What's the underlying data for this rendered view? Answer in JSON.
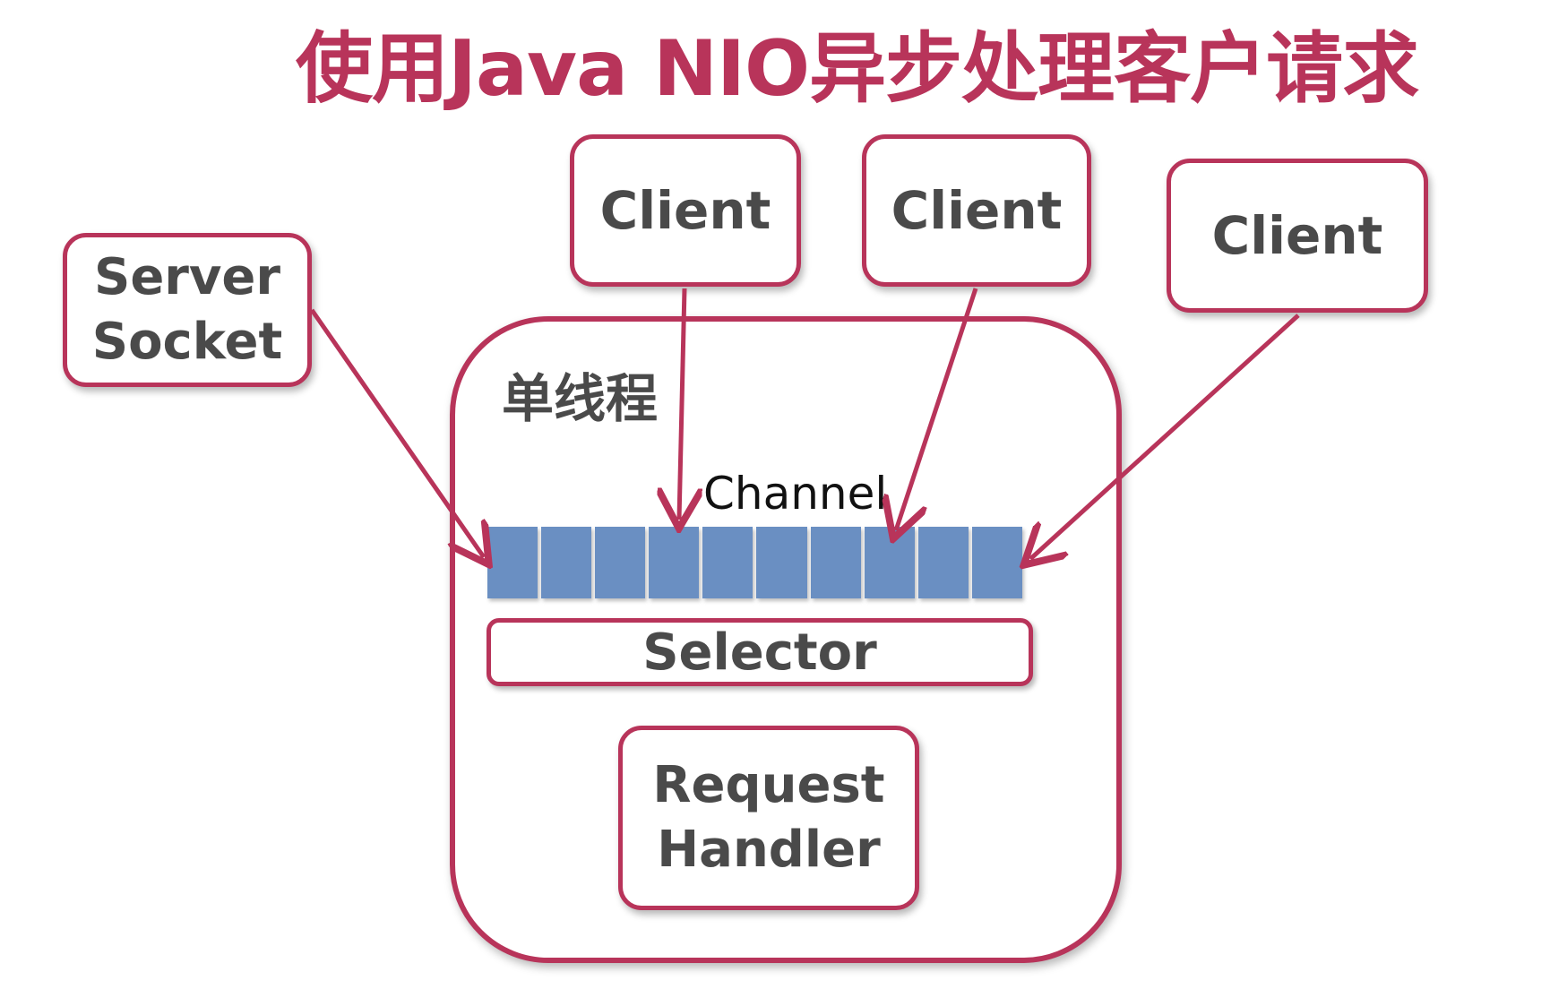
{
  "title": "使用Java NIO异步处理客户请求",
  "server_socket": {
    "line1": "Server",
    "line2": "Socket"
  },
  "clients": [
    {
      "label": "Client"
    },
    {
      "label": "Client"
    },
    {
      "label": "Client"
    }
  ],
  "thread": {
    "label": "单线程"
  },
  "channel": {
    "label": "Channel"
  },
  "selector": {
    "label": "Selector"
  },
  "request_handler": {
    "line1": "Request",
    "line2": "Handler"
  },
  "colors": {
    "accent": "#b8345a",
    "channel_cell": "#6a8fc2",
    "text": "#4a4a4a"
  }
}
